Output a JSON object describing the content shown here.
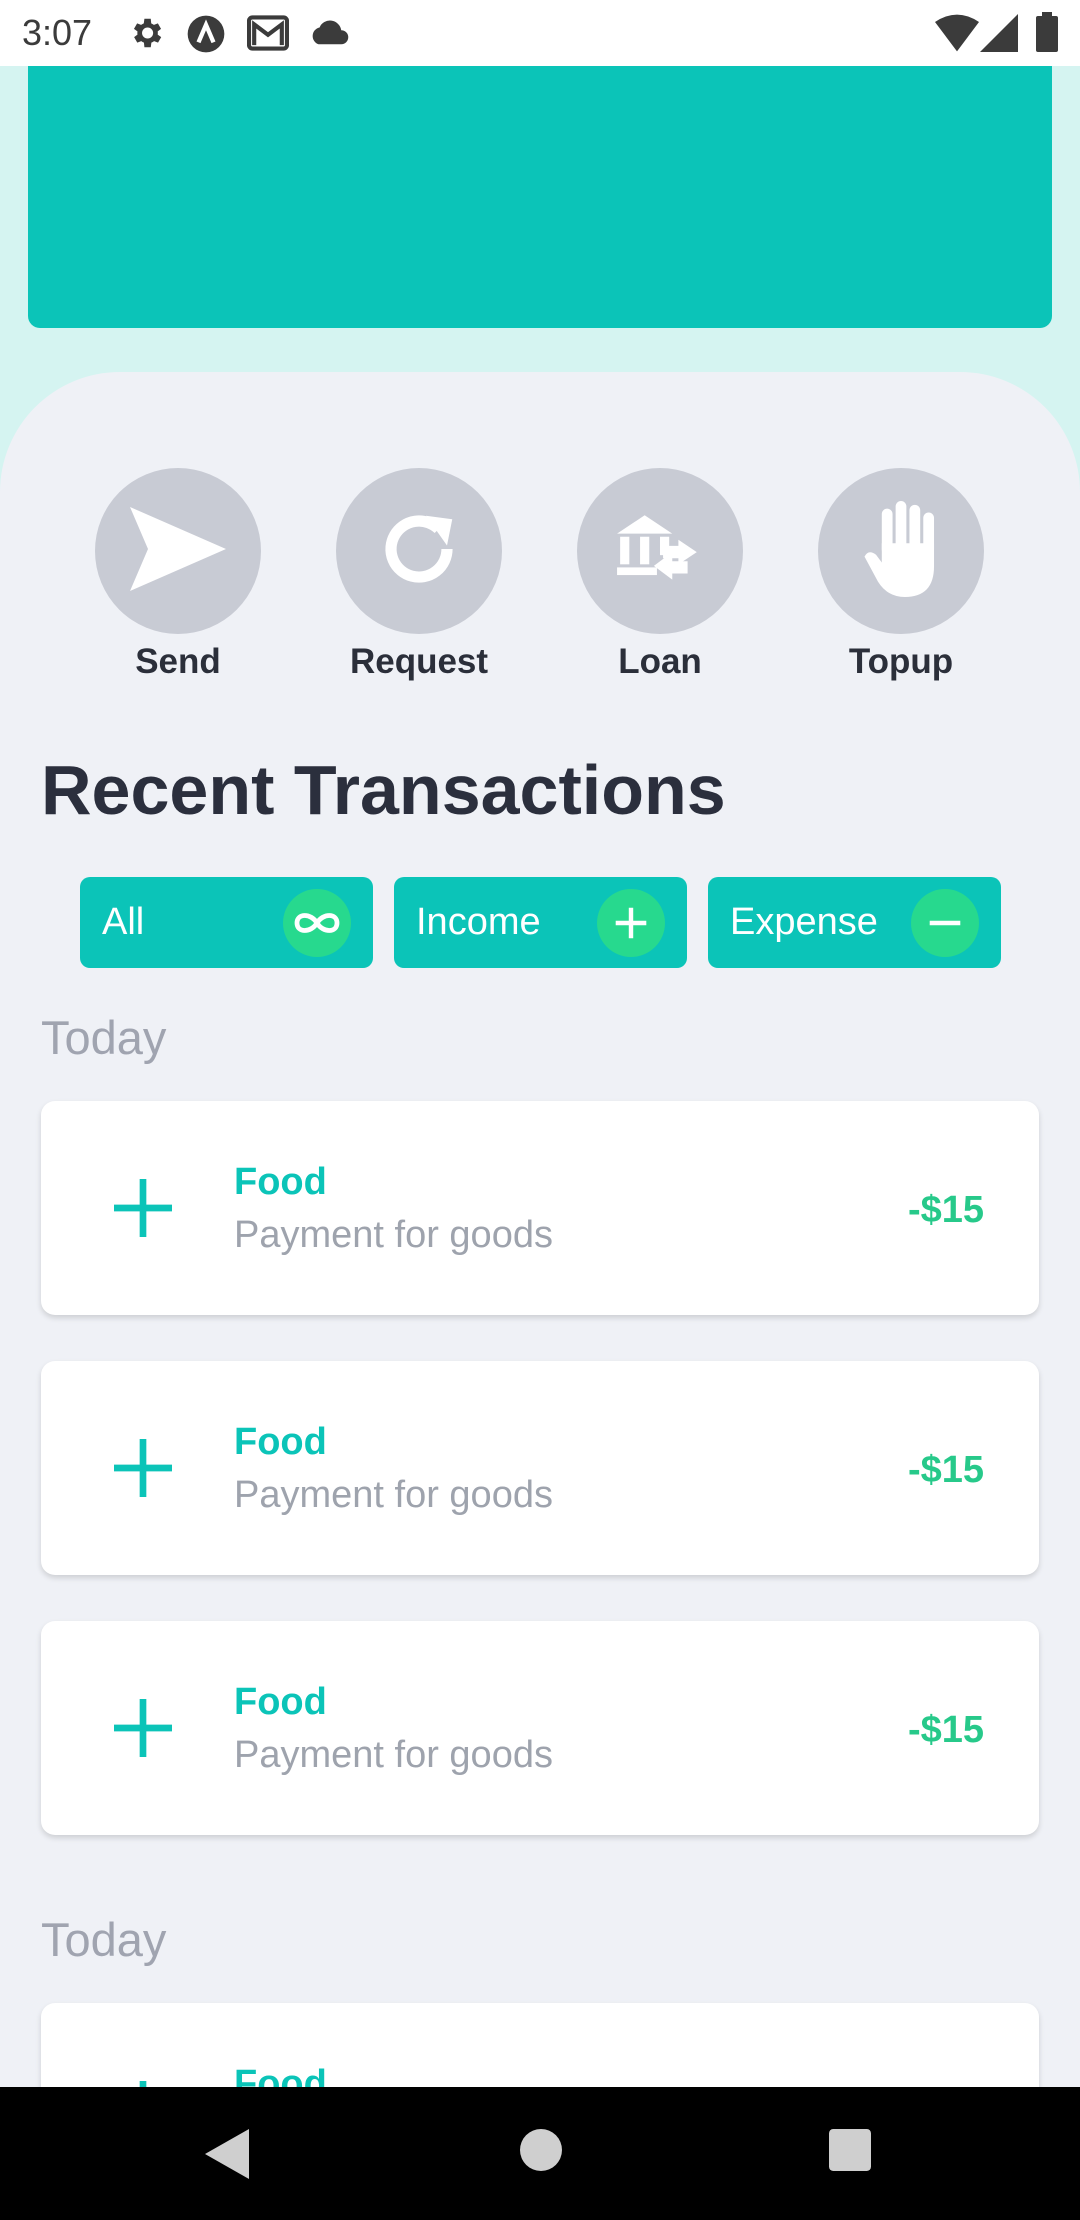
{
  "status_bar": {
    "time": "3:07",
    "left_icons": [
      "gear-icon",
      "a-badge-icon",
      "gmail-icon",
      "cloud-icon"
    ],
    "right_icons": [
      "wifi-icon",
      "signal-icon",
      "battery-icon"
    ]
  },
  "colors": {
    "accent": "#0bc4b8",
    "positive": "#27d98e",
    "amount": "#27c98a",
    "panel": "#eff1f6",
    "action_circle": "#c8cbd4"
  },
  "actions": [
    {
      "label": "Send",
      "icon": "send-icon"
    },
    {
      "label": "Request",
      "icon": "refresh-icon"
    },
    {
      "label": "Loan",
      "icon": "bank-transfer-icon"
    },
    {
      "label": "Topup",
      "icon": "hand-icon"
    }
  ],
  "recent": {
    "title": "Recent Transactions",
    "filters": [
      {
        "label": "All",
        "icon": "infinity-icon"
      },
      {
        "label": "Income",
        "icon": "plus-icon"
      },
      {
        "label": "Expense",
        "icon": "minus-icon"
      }
    ]
  },
  "groups": [
    {
      "day": "Today",
      "transactions": [
        {
          "category": "Food",
          "description": "Payment for goods",
          "amount": "-$15"
        },
        {
          "category": "Food",
          "description": "Payment for goods",
          "amount": "-$15"
        },
        {
          "category": "Food",
          "description": "Payment for goods",
          "amount": "-$15"
        }
      ]
    },
    {
      "day": "Today",
      "transactions": [
        {
          "category": "Food",
          "description": "",
          "amount": ""
        }
      ]
    }
  ],
  "nav_bar": {
    "buttons": [
      "back-icon",
      "home-icon",
      "recents-icon"
    ]
  }
}
